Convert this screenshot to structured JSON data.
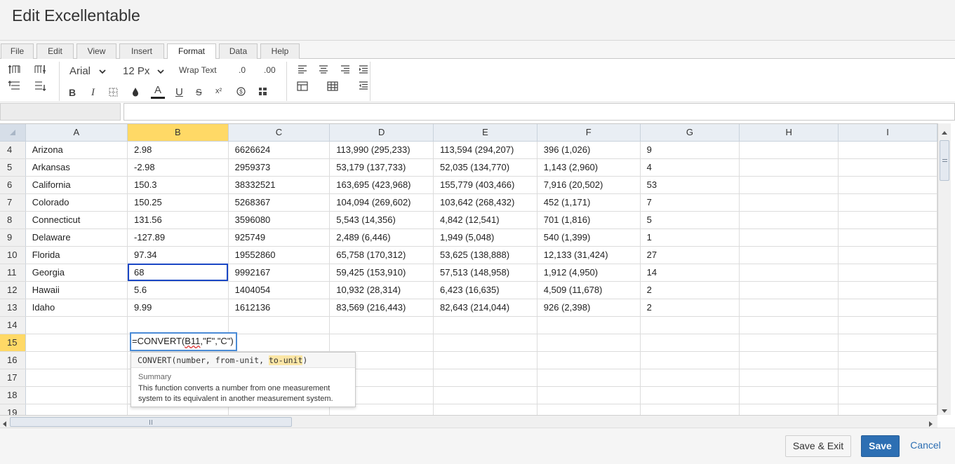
{
  "window": {
    "title": "Edit Excellentable"
  },
  "menu_tabs": [
    {
      "label": "File",
      "active": false
    },
    {
      "label": "Edit",
      "active": false
    },
    {
      "label": "View",
      "active": false
    },
    {
      "label": "Insert",
      "active": false
    },
    {
      "label": "Format",
      "active": true
    },
    {
      "label": "Data",
      "active": false
    },
    {
      "label": "Help",
      "active": false
    }
  ],
  "ribbon": {
    "font_family": "Arial",
    "font_size": "12 Px",
    "wrap_text": "Wrap Text",
    "decimal_decrease": ".0",
    "decimal_increase": ".00",
    "bold": "B",
    "italic": "I",
    "font_color": "A",
    "underline": "U",
    "strikethrough": "S",
    "superscript": "x²"
  },
  "formula_bar": {
    "name_box": "",
    "formula": ""
  },
  "grid": {
    "columns": [
      "A",
      "B",
      "C",
      "D",
      "E",
      "F",
      "G",
      "H",
      "I"
    ],
    "selected_column": "B",
    "selected_row": "15",
    "rows": [
      {
        "num": "4",
        "cells": [
          "Arizona",
          "2.98",
          "6626624",
          "113,990 (295,233)",
          "113,594 (294,207)",
          "396 (1,026)",
          "9",
          "",
          ""
        ]
      },
      {
        "num": "5",
        "cells": [
          "Arkansas",
          "-2.98",
          "2959373",
          "53,179 (137,733)",
          "52,035 (134,770)",
          "1,143 (2,960)",
          "4",
          "",
          ""
        ]
      },
      {
        "num": "6",
        "cells": [
          "California",
          "150.3",
          "38332521",
          "163,695 (423,968)",
          "155,779 (403,466)",
          "7,916 (20,502)",
          "53",
          "",
          ""
        ]
      },
      {
        "num": "7",
        "cells": [
          "Colorado",
          "150.25",
          "5268367",
          "104,094 (269,602)",
          "103,642 (268,432)",
          "452 (1,171)",
          "7",
          "",
          ""
        ]
      },
      {
        "num": "8",
        "cells": [
          "Connecticut",
          "131.56",
          "3596080",
          "5,543 (14,356)",
          "4,842 (12,541)",
          "701 (1,816)",
          "5",
          "",
          ""
        ]
      },
      {
        "num": "9",
        "cells": [
          "Delaware",
          "-127.89",
          "925749",
          "2,489 (6,446)",
          "1,949 (5,048)",
          "540 (1,399)",
          "1",
          "",
          ""
        ]
      },
      {
        "num": "10",
        "cells": [
          "Florida",
          "97.34",
          "19552860",
          "65,758 (170,312)",
          "53,625 (138,888)",
          "12,133 (31,424)",
          "27",
          "",
          ""
        ]
      },
      {
        "num": "11",
        "cells": [
          "Georgia",
          "68",
          "9992167",
          "59,425 (153,910)",
          "57,513 (148,958)",
          "1,912 (4,950)",
          "14",
          "",
          ""
        ]
      },
      {
        "num": "12",
        "cells": [
          "Hawaii",
          "5.6",
          "1404054",
          "10,932 (28,314)",
          "6,423 (16,635)",
          "4,509 (11,678)",
          "2",
          "",
          ""
        ]
      },
      {
        "num": "13",
        "cells": [
          "Idaho",
          "9.99",
          "1612136",
          "83,569 (216,443)",
          "82,643 (214,044)",
          "926 (2,398)",
          "2",
          "",
          ""
        ]
      },
      {
        "num": "14",
        "cells": [
          "",
          "",
          "",
          "",
          "",
          "",
          "",
          "",
          ""
        ]
      },
      {
        "num": "15",
        "cells": [
          "",
          "",
          "",
          "",
          "",
          "",
          "",
          "",
          ""
        ]
      },
      {
        "num": "16",
        "cells": [
          "",
          "",
          "",
          "",
          "",
          "",
          "",
          "",
          ""
        ]
      },
      {
        "num": "17",
        "cells": [
          "",
          "",
          "",
          "",
          "",
          "",
          "",
          "",
          ""
        ]
      },
      {
        "num": "18",
        "cells": [
          "",
          "",
          "",
          "",
          "",
          "",
          "",
          "",
          ""
        ]
      },
      {
        "num": "19",
        "cells": [
          "",
          "",
          "",
          "",
          "",
          "",
          "",
          "",
          ""
        ]
      }
    ]
  },
  "cell_editor": {
    "prefix": "=CONVERT(",
    "ref": "B11",
    "suffix": ",\"F\",\"C\")"
  },
  "function_tooltip": {
    "signature_start": "CONVERT(number, from-unit, ",
    "signature_highlight": "to-unit",
    "signature_end": ")",
    "summary_label": "Summary",
    "description": "This function converts a number from one measurement system to its equivalent in another measurement system."
  },
  "footer": {
    "save_exit": "Save & Exit",
    "save": "Save",
    "cancel": "Cancel"
  },
  "colors": {
    "accent": "#2d6fb3",
    "selection_header": "#ffd966",
    "active_cell_border": "#1a47c5",
    "editor_border": "#4a8bd6"
  }
}
